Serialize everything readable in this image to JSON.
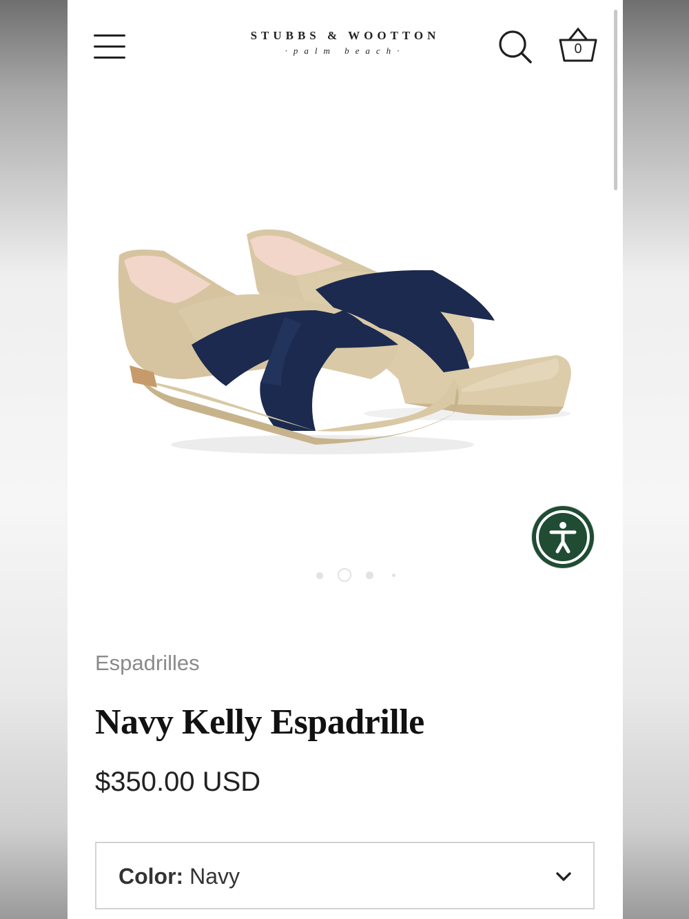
{
  "header": {
    "brand": "STUBBS & WOOTTON",
    "tagline": "·palm beach·",
    "cart_count": "0",
    "icons": [
      "hamburger-menu-icon",
      "search-icon",
      "basket-icon"
    ]
  },
  "carousel": {
    "slides": 4,
    "active_index": 1
  },
  "accessibility": {
    "icon": "accessibility-person-icon",
    "color": "#1f4c33"
  },
  "product": {
    "category": "Espadrilles",
    "title": "Navy Kelly Espadrille",
    "price": "$350.00 USD",
    "color_label": "Color:",
    "color_value": "Navy"
  },
  "colors": {
    "navy": "#1b2a4e",
    "jute": "#d9c9a8",
    "footbed": "#f2d6c9"
  }
}
